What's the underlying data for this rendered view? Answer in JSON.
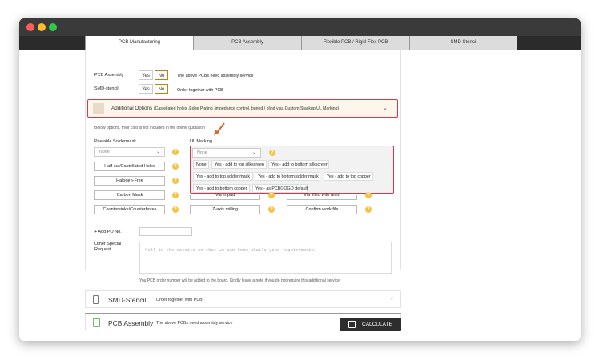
{
  "tabs": [
    "PCB Manufacturing",
    "PCB Assembly",
    "Flexible PCB / Rigid-Flex PCB",
    "SMD Stencil"
  ],
  "assembly_row": {
    "label": "PCB Assembly",
    "yes": "Yes",
    "no": "No",
    "note": "The above PCBs need assembly service"
  },
  "stencil_row": {
    "label": "SMD-stencil",
    "yes": "Yes",
    "no": "No",
    "note": "Order together with PCB"
  },
  "additional_options": {
    "title": "Additional Options",
    "detail": "(Castellated holes ,Edge Plating ,impedance control, buried / blind vias,Custom Stackup,UL Marking)",
    "chevron": "⌄"
  },
  "below_note": "Below options, their cost is not included in the online quotation",
  "peelable": {
    "label": "Peelable Soldermask",
    "value": "None"
  },
  "ul_marking": {
    "label": "UL Marking",
    "value": "None",
    "options": [
      "None",
      "Yes - add to top silkscreen",
      "Yes - add to bottom silkscreen",
      "Yes - add to top solder mask",
      "Yes - add to bottom solder mask",
      "Yes - add to top copper",
      "Yes - add to bottom copper",
      "Yes - as PCBGOGO default"
    ]
  },
  "left_buttons": [
    "Half-cut/Castellated Holes",
    "Halogen-Free",
    "Carbon Mask",
    "Countersinks/Counterbores"
  ],
  "mid_buttons": [
    "Via in pad",
    "Z-axis milling"
  ],
  "right_buttons": [
    "Via filled with resin",
    "Confirm work file"
  ],
  "po": {
    "label": "+ Add PO No."
  },
  "special": {
    "label": "Other Special Request",
    "placeholder": "Fill in the details so that we can know what's your requirements."
  },
  "order_note": "You PCB order number will be added to the board. Kindly leave a note if you do not require this additional service.",
  "smd_section": {
    "title": "SMD-Stencil",
    "desc": "Order together with PCB"
  },
  "assembly_section": {
    "title": "PCB Assembly",
    "desc": "The above PCBs need assembly service"
  },
  "calculate": "CALCULATE",
  "colors": {
    "highlight": "#d33a4e",
    "help": "#f3c44a",
    "select_border": "#b8860b"
  }
}
